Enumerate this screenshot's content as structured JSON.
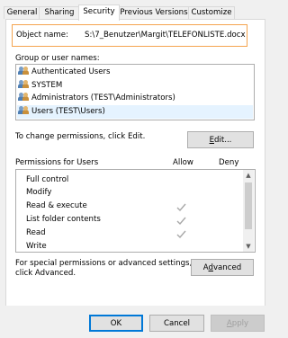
{
  "tabs": [
    {
      "label": "General"
    },
    {
      "label": "Sharing"
    },
    {
      "label": "Security"
    },
    {
      "label": "Previous Versions"
    },
    {
      "label": "Customize"
    }
  ],
  "active_tab": "Security",
  "object_name": {
    "label": "Object name:",
    "value": "S:\\7_Benutzer\\Margit\\TELEFONLISTE.docx"
  },
  "groups": {
    "label": "Group or user names:",
    "items": [
      {
        "label": "Authenticated Users",
        "icon": "users-icon"
      },
      {
        "label": "SYSTEM",
        "icon": "users-icon"
      },
      {
        "label": "Administrators (TEST\\Administrators)",
        "icon": "users-icon"
      },
      {
        "label": "Users (TEST\\Users)",
        "icon": "users-icon",
        "selected": true
      }
    ]
  },
  "change_text": "To change permissions, click Edit.",
  "edit_button": "Edit...",
  "permissions": {
    "title": "Permissions for Users",
    "allow_header": "Allow",
    "deny_header": "Deny",
    "rows": [
      {
        "name": "Full control",
        "allow": false,
        "deny": false
      },
      {
        "name": "Modify",
        "allow": false,
        "deny": false
      },
      {
        "name": "Read & execute",
        "allow": true,
        "deny": false
      },
      {
        "name": "List folder contents",
        "allow": true,
        "deny": false
      },
      {
        "name": "Read",
        "allow": true,
        "deny": false
      },
      {
        "name": "Write",
        "allow": false,
        "deny": false
      }
    ]
  },
  "special_text": "For special permissions or advanced settings,\nclick Advanced.",
  "special_text_line1": "For special permissions or advanced settings,",
  "special_text_line2": "click Advanced.",
  "advanced_button": "Advanced",
  "footer": {
    "ok": "OK",
    "cancel": "Cancel",
    "apply": "Apply"
  },
  "colors": {
    "highlight_border": "#f4a44f",
    "selected_row": "#e5f3ff",
    "check": "#a8a8a8",
    "default_button_border": "#0078d7"
  }
}
